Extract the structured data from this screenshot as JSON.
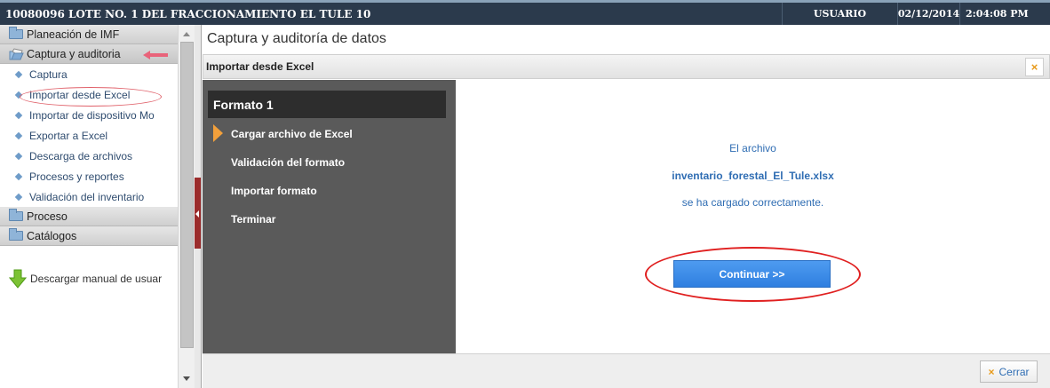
{
  "topbar": {
    "title": "10080096 LOTE NO. 1 DEL FRACCIONAMIENTO EL TULE 10",
    "user": "USUARIO",
    "date": "02/12/2014",
    "time": "2:04:08 PM"
  },
  "sidebar": {
    "sections": [
      {
        "label": "Planeación de IMF"
      },
      {
        "label": "Captura y auditoria"
      },
      {
        "label": "Proceso"
      },
      {
        "label": "Catálogos"
      }
    ],
    "items": [
      {
        "label": "Captura"
      },
      {
        "label": "Importar desde Excel"
      },
      {
        "label": "Importar de dispositivo Mo"
      },
      {
        "label": "Exportar a Excel"
      },
      {
        "label": "Descarga de archivos"
      },
      {
        "label": "Procesos y reportes"
      },
      {
        "label": "Validación del inventario"
      }
    ],
    "download_label": "Descargar manual de usuar"
  },
  "main": {
    "page_title": "Captura y auditoría de datos",
    "dialog_title": "Importar desde Excel",
    "close_icon": "×"
  },
  "wizard": {
    "title": "Formato 1",
    "steps": [
      {
        "label": "Cargar archivo de Excel"
      },
      {
        "label": "Validación del formato"
      },
      {
        "label": "Importar formato"
      },
      {
        "label": "Terminar"
      }
    ]
  },
  "content": {
    "line1": "El archivo",
    "filename": "inventario_forestal_El_Tule.xlsx",
    "line3": "se ha cargado correctamente.",
    "continue_label": "Continuar >>"
  },
  "footer": {
    "close_label": "Cerrar",
    "close_icon": "×"
  },
  "colors": {
    "topbar": "#2b3a4c",
    "accent_blue": "#2f6db3",
    "button_blue": "#3a8ae6",
    "annotation_red": "#e02020",
    "wizard_bg": "#5a5a5a",
    "wizard_marker": "#f2a03b"
  }
}
